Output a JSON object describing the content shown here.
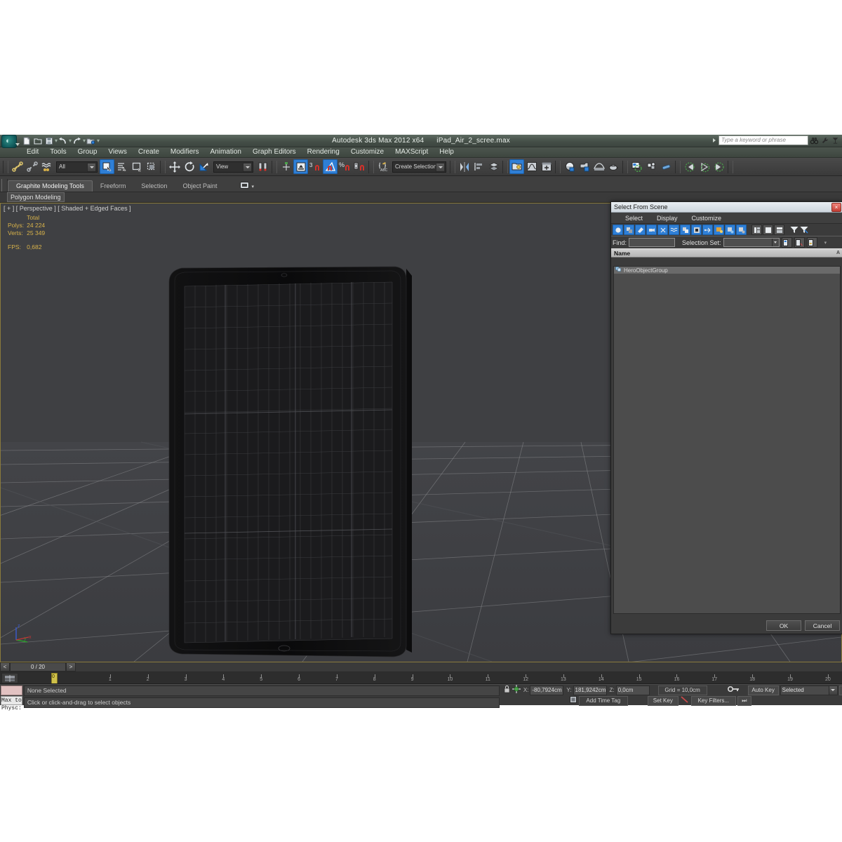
{
  "app": {
    "title": "Autodesk 3ds Max  2012 x64",
    "filename": "iPad_Air_2_scree.max",
    "logo_glyph": "S"
  },
  "quick_access": [
    {
      "name": "new-file-icon",
      "label": "New"
    },
    {
      "name": "open-file-icon",
      "label": "Open"
    },
    {
      "name": "save-file-icon",
      "label": "Save"
    },
    {
      "name": "undo-icon",
      "label": "Undo"
    },
    {
      "name": "redo-icon",
      "label": "Redo"
    },
    {
      "name": "set-project-folder-icon",
      "label": "Set Project Folder"
    }
  ],
  "search": {
    "placeholder": "Type a keyword or phrase",
    "icons": [
      "binoculars-icon",
      "wrench-icon",
      "help-icon"
    ]
  },
  "menu": {
    "items": [
      "Edit",
      "Tools",
      "Group",
      "Views",
      "Create",
      "Modifiers",
      "Animation",
      "Graph Editors",
      "Rendering",
      "Customize",
      "MAXScript",
      "Help"
    ]
  },
  "toolbar": {
    "selection_filter": "All",
    "reference_coord": "View",
    "named_selection_set": "Create Selection Se",
    "angle_snap_value": "3",
    "percent_snap_label": "%"
  },
  "ribbon": {
    "tabs": [
      "Graphite Modeling Tools",
      "Freeform",
      "Selection",
      "Object Paint"
    ],
    "active_tab": "Graphite Modeling Tools",
    "subtab": "Polygon Modeling"
  },
  "viewport": {
    "label": "[ + ] [ Perspective ] [ Shaded + Edged Faces ]",
    "stats": {
      "header": "Total",
      "polys_label": "Polys:",
      "polys_value": "24 224",
      "verts_label": "Verts:",
      "verts_value": "25 349",
      "fps_label": "FPS:",
      "fps_value": "0,682"
    },
    "axis": {
      "x": "x",
      "y": "y",
      "z": "z"
    },
    "background_color": "#3f4043",
    "border_color": "#8a7a3c"
  },
  "timeline": {
    "current_frame": "0 / 20",
    "prev_label": "<",
    "next_label": ">",
    "ticks": [
      "1",
      "2",
      "3",
      "4",
      "5",
      "6",
      "7",
      "8",
      "9",
      "10",
      "11",
      "12",
      "13",
      "14",
      "15",
      "16",
      "17",
      "18",
      "19",
      "20"
    ],
    "frame_marker": "0"
  },
  "status": {
    "material_label": "Max to Physc:",
    "selection_status": "None Selected",
    "prompt": "Click or click-and-drag to select objects",
    "lock_icon": "lock-icon",
    "transform_icon": "absolute-relative-icon",
    "coords": [
      {
        "axis": "X:",
        "value": "-80,7924cm"
      },
      {
        "axis": "Y:",
        "value": "181,9242cm"
      },
      {
        "axis": "Z:",
        "value": "0,0cm"
      }
    ],
    "grid": "Grid = 10,0cm",
    "add_time_tag": "Add Time Tag",
    "auto_key": "Auto Key",
    "set_key": "Set Key",
    "key_mode": "Selected",
    "key_filters": "Key Filters..."
  },
  "dialog": {
    "title": "Select From Scene",
    "close_label": "×",
    "menu": [
      "Select",
      "Display",
      "Customize"
    ],
    "toolbar_icons": [
      {
        "name": "display-geometry-icon",
        "active": true
      },
      {
        "name": "display-shapes-icon",
        "active": true
      },
      {
        "name": "display-lights-icon",
        "active": true
      },
      {
        "name": "display-cameras-icon",
        "active": true
      },
      {
        "name": "display-helpers-icon",
        "active": true
      },
      {
        "name": "display-space-warps-icon",
        "active": true
      },
      {
        "name": "display-groups-icon",
        "active": true
      },
      {
        "name": "display-xrefs-icon",
        "active": true
      },
      {
        "name": "display-bones-icon",
        "active": true
      },
      {
        "name": "display-children-icon",
        "active": true
      },
      {
        "name": "display-influences-icon",
        "active": true
      },
      {
        "name": "display-frozen-icon",
        "active": true
      },
      {
        "name": "expand-all-icon",
        "active": false
      },
      {
        "name": "collapse-all-icon",
        "active": false
      },
      {
        "name": "expand-selected-icon",
        "active": false
      },
      {
        "name": "filter-icon",
        "active": false
      },
      {
        "name": "clear-filter-icon",
        "active": false
      }
    ],
    "find_label": "Find:",
    "find_value": "",
    "selection_set_label": "Selection Set:",
    "selection_set_value": "",
    "column_header": "Name",
    "sort_indicator": "A",
    "items": [
      {
        "name": "HeroObjectGroup",
        "icon": "group-icon"
      }
    ],
    "ok_label": "OK",
    "cancel_label": "Cancel"
  }
}
